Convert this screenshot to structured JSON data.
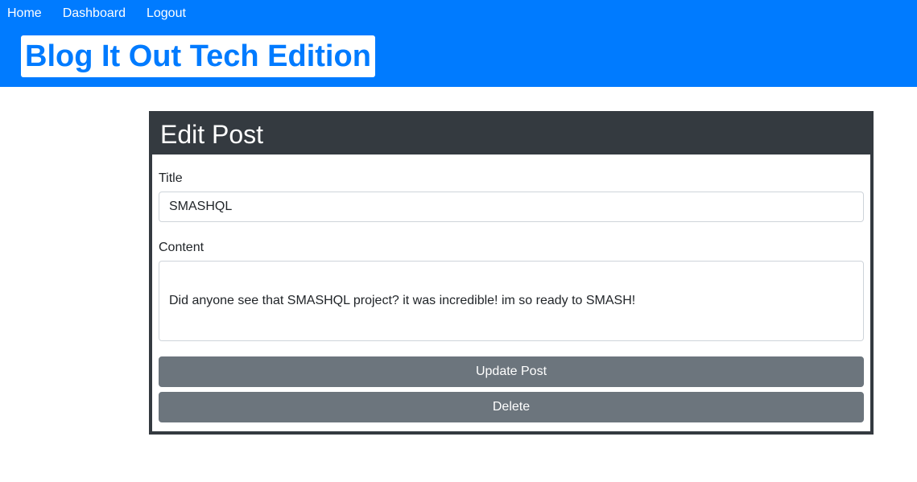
{
  "nav": {
    "items": [
      {
        "label": "Home"
      },
      {
        "label": "Dashboard"
      },
      {
        "label": "Logout"
      }
    ]
  },
  "brand": {
    "title": "Blog It Out Tech Edition"
  },
  "edit_post": {
    "header": "Edit Post",
    "title_label": "Title",
    "title_value": "SMASHQL",
    "content_label": "Content",
    "content_value": "Did anyone see that SMASHQL project? it was incredible! im so ready to SMASH!",
    "update_button": "Update Post",
    "delete_button": "Delete"
  },
  "colors": {
    "primary": "#007bff",
    "dark": "#343a40",
    "secondary": "#6c757d"
  }
}
